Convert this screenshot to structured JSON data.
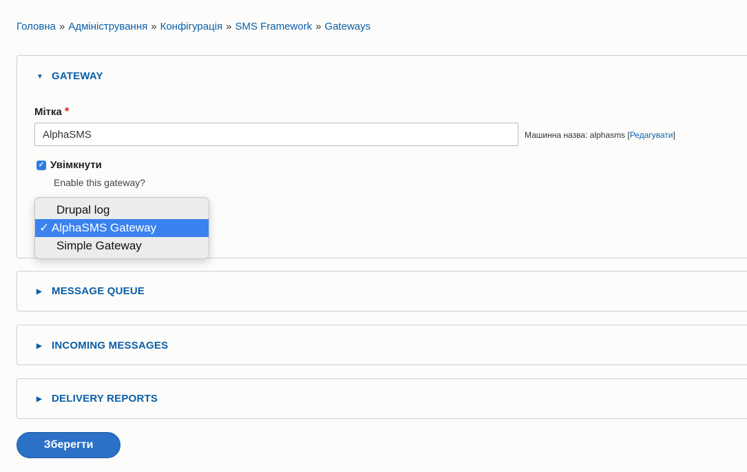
{
  "breadcrumb": [
    "Головна",
    "Адміністрування",
    "Конфігурація",
    "SMS Framework",
    "Gateways"
  ],
  "breadcrumb_sep": "»",
  "sections": {
    "gateway": "GATEWAY",
    "message_queue": "MESSAGE QUEUE",
    "incoming_messages": "INCOMING MESSAGES",
    "delivery_reports": "DELIVERY REPORTS"
  },
  "form": {
    "label": "Мітка",
    "required_mark": "*",
    "label_value": "AlphaSMS",
    "machine_name_prefix": "Машинна назва: alphasms",
    "machine_name_edit": "Редагувати",
    "enable_label": "Увімкнути",
    "enable_description": "Enable this gateway?"
  },
  "dropdown": {
    "options": [
      "Drupal log",
      "AlphaSMS Gateway",
      "Simple Gateway"
    ],
    "selected": "AlphaSMS Gateway",
    "check": "✓"
  },
  "save_label": "Зберегти",
  "colors": {
    "accent": "#0b5ea8",
    "button": "#2a71c7",
    "selection": "#3a82f0",
    "required": "#e02828"
  }
}
